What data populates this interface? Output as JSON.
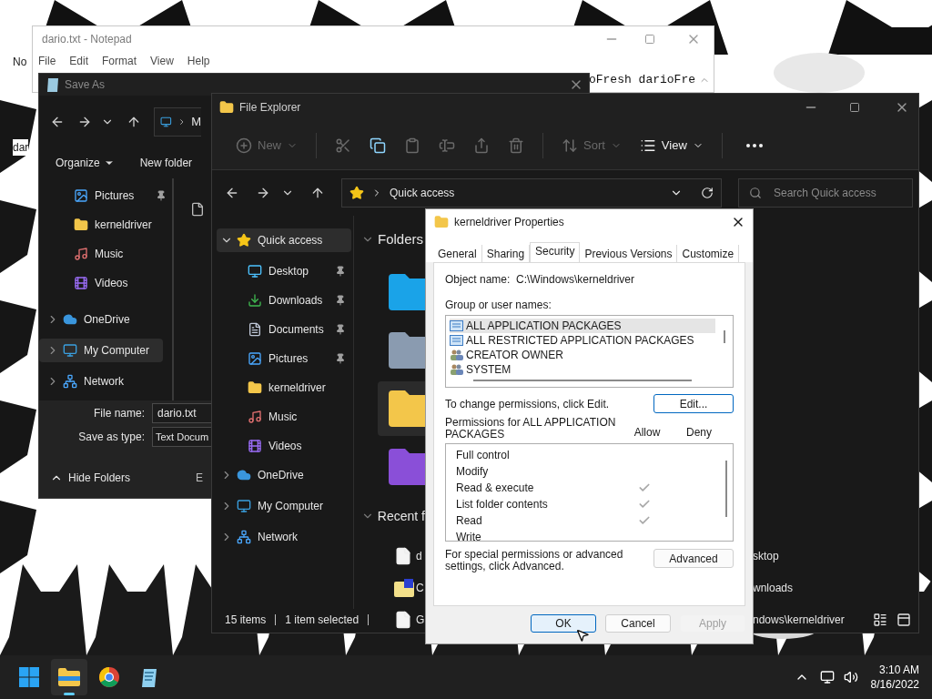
{
  "desktop": {
    "icons": [
      {
        "label": "No"
      },
      {
        "label": "dar"
      }
    ]
  },
  "notepad": {
    "title": "dario.txt - Notepad",
    "menu": [
      "File",
      "Edit",
      "Format",
      "View",
      "Help"
    ],
    "text": "oFresh darioFre"
  },
  "save_as": {
    "title": "Save As",
    "address": "M",
    "commands": [
      {
        "label": "Organize",
        "menu": true
      },
      {
        "label": "New folder",
        "menu": false
      }
    ],
    "quick_access_items": [
      {
        "label": "Pictures",
        "kind": "pictures",
        "pinned": true,
        "selected": false
      },
      {
        "label": "kerneldriver",
        "kind": "folder",
        "pinned": false,
        "selected": false
      },
      {
        "label": "Music",
        "kind": "music",
        "pinned": false,
        "selected": false
      },
      {
        "label": "Videos",
        "kind": "videos",
        "pinned": false,
        "selected": false
      }
    ],
    "locations": [
      {
        "label": "OneDrive",
        "kind": "onedrive",
        "expanded": false,
        "selected": false
      },
      {
        "label": "My Computer",
        "kind": "computer",
        "expanded": false,
        "selected": true
      },
      {
        "label": "Network",
        "kind": "network",
        "expanded": false,
        "selected": false
      }
    ],
    "file_name_label": "File name:",
    "file_name": "dario.txt",
    "type_label": "Save as type:",
    "type": "Text Docum",
    "hide_folders": "Hide Folders",
    "encoding_label": "E"
  },
  "explorer": {
    "title": "File Explorer",
    "toolbar": [
      {
        "kind": "new",
        "label": "New",
        "disabled": true
      },
      {
        "kind": "cut",
        "disabled": true
      },
      {
        "kind": "copy",
        "disabled": false
      },
      {
        "kind": "paste",
        "disabled": true
      },
      {
        "kind": "rename",
        "disabled": true
      },
      {
        "kind": "share",
        "disabled": true
      },
      {
        "kind": "delete",
        "disabled": true
      },
      {
        "kind": "sort",
        "label": "Sort",
        "disabled": true
      },
      {
        "kind": "view",
        "label": "View",
        "disabled": false
      },
      {
        "kind": "more",
        "disabled": false
      }
    ],
    "address": "Quick access",
    "search": {
      "placeholder": "Search Quick access"
    },
    "nav": [
      {
        "label": "Quick access",
        "kind": "star",
        "expanded": true,
        "selected": true,
        "children": [
          {
            "label": "Desktop",
            "kind": "desktop",
            "pinned": true,
            "selected": false
          },
          {
            "label": "Downloads",
            "kind": "downloads",
            "pinned": true,
            "selected": false
          },
          {
            "label": "Documents",
            "kind": "documents",
            "pinned": true,
            "selected": false
          },
          {
            "label": "Pictures",
            "kind": "pictures",
            "pinned": true,
            "selected": false
          },
          {
            "label": "kerneldriver",
            "kind": "folder",
            "pinned": false,
            "selected": false
          },
          {
            "label": "Music",
            "kind": "music",
            "pinned": false,
            "selected": false
          },
          {
            "label": "Videos",
            "kind": "videos",
            "pinned": false,
            "selected": false
          }
        ]
      },
      {
        "label": "OneDrive",
        "kind": "onedrive",
        "expanded": false,
        "selected": false
      },
      {
        "label": "My Computer",
        "kind": "computer",
        "expanded": false,
        "selected": false
      },
      {
        "label": "Network",
        "kind": "network",
        "expanded": false,
        "selected": false
      }
    ],
    "folders": {
      "title": "Folders",
      "expanded": true,
      "items": [
        {
          "kind": "desktop",
          "selected": false
        },
        {
          "kind": "documents",
          "selected": false
        },
        {
          "kind": "folder",
          "selected": true
        },
        {
          "kind": "videos",
          "selected": false
        }
      ]
    },
    "recent": {
      "title": "Recent f",
      "expanded": true,
      "items": [
        {
          "kind": "document",
          "name": "d",
          "location": "sktop",
          "selected": false
        },
        {
          "kind": "archive",
          "name": "C",
          "location": "wnloads",
          "selected": false
        },
        {
          "kind": "document",
          "name": "G",
          "location": "ndows\\kerneldriver",
          "selected": false
        }
      ]
    },
    "status": [
      "15 items",
      "1 item selected"
    ]
  },
  "properties": {
    "title": "kerneldriver Properties",
    "tabs": [
      {
        "label": "General",
        "selected": false
      },
      {
        "label": "Sharing",
        "selected": false
      },
      {
        "label": "Security",
        "selected": true
      },
      {
        "label": "Previous Versions",
        "selected": false
      },
      {
        "label": "Customize",
        "selected": false
      }
    ],
    "object_name_label": "Object name:",
    "object_name": "C:\\Windows\\kerneldriver",
    "groups_label": "Group or user names:",
    "groups": [
      {
        "name": "ALL APPLICATION PACKAGES",
        "kind": "package",
        "selected": true
      },
      {
        "name": "ALL RESTRICTED APPLICATION PACKAGES",
        "kind": "package",
        "selected": false
      },
      {
        "name": "CREATOR OWNER",
        "kind": "users",
        "selected": false
      },
      {
        "name": "SYSTEM",
        "kind": "users",
        "selected": false
      }
    ],
    "change_hint": "To change permissions, click Edit.",
    "edit_button": "Edit...",
    "permissions_label": "Permissions for ALL APPLICATION PACKAGES",
    "allow_label": "Allow",
    "deny_label": "Deny",
    "permissions": [
      {
        "name": "Full control",
        "allow": false,
        "deny": false
      },
      {
        "name": "Modify",
        "allow": false,
        "deny": false
      },
      {
        "name": "Read & execute",
        "allow": true,
        "deny": false
      },
      {
        "name": "List folder contents",
        "allow": true,
        "deny": false
      },
      {
        "name": "Read",
        "allow": true,
        "deny": false
      },
      {
        "name": "Write",
        "allow": false,
        "deny": false
      }
    ],
    "advanced_hint": "For special permissions or advanced settings, click Advanced.",
    "advanced_button": "Advanced",
    "buttons": [
      {
        "label": "OK",
        "kind": "default",
        "disabled": false
      },
      {
        "label": "Cancel",
        "kind": "normal",
        "disabled": false
      },
      {
        "label": "Apply",
        "kind": "normal",
        "disabled": true
      }
    ]
  },
  "taskbar": {
    "apps": [
      {
        "kind": "start",
        "active": false
      },
      {
        "kind": "explorer",
        "active": true
      },
      {
        "kind": "browser",
        "active": false
      },
      {
        "kind": "notepad",
        "active": false
      }
    ],
    "time": "3:10 AM",
    "date": "8/16/2022"
  }
}
